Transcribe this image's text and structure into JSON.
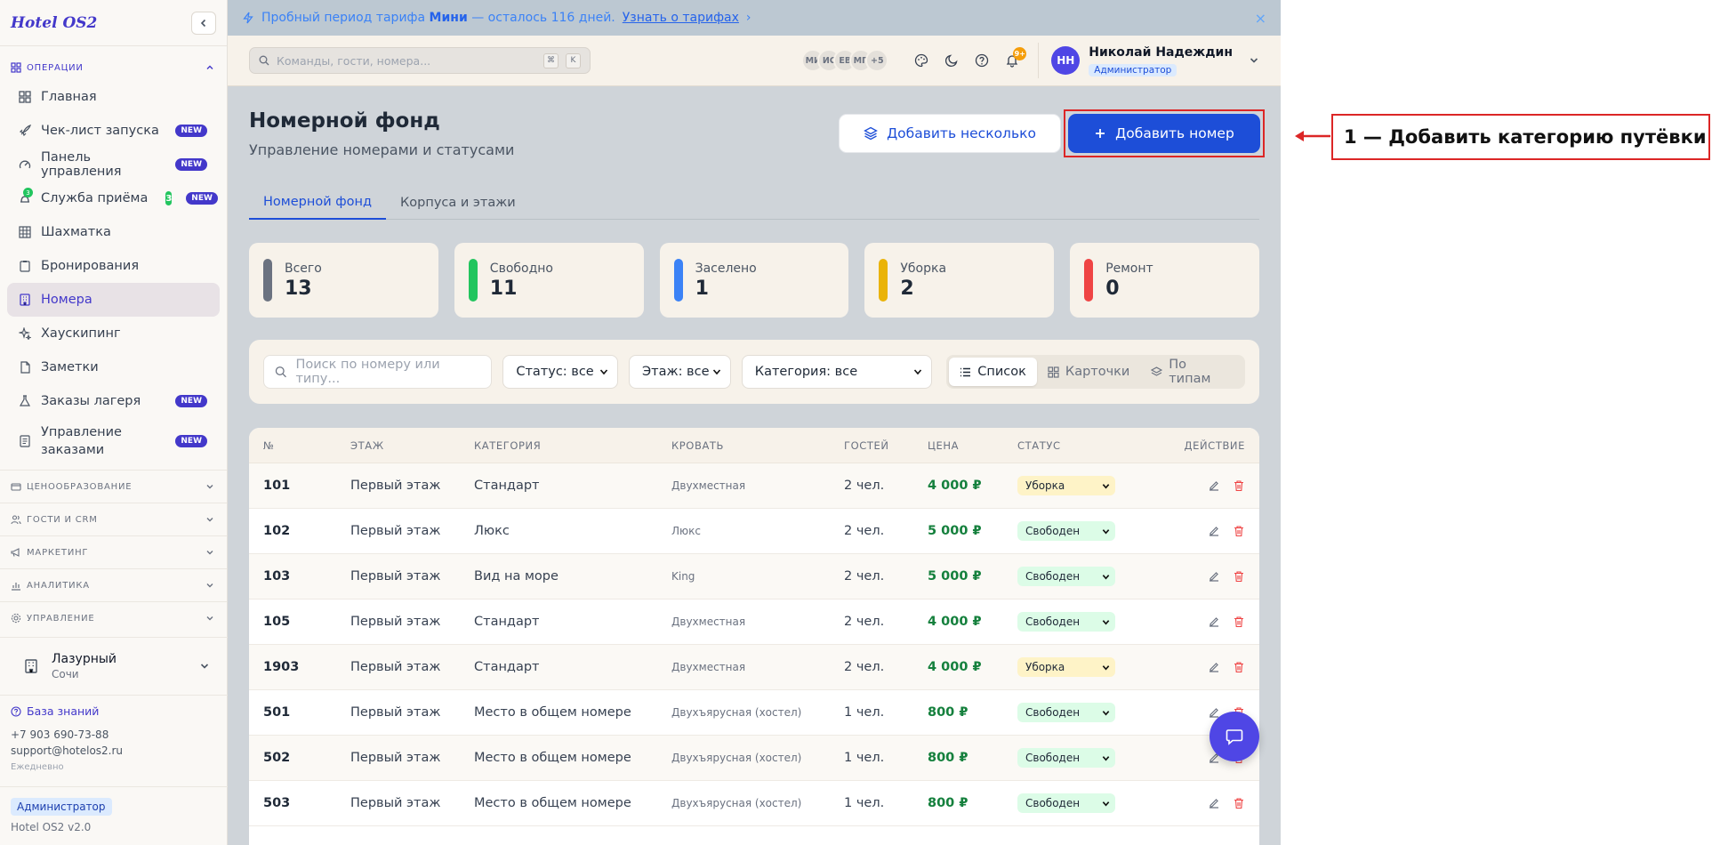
{
  "sidebar": {
    "logo": "Hotel OS2",
    "section_ops": "ОПЕРАЦИИ",
    "items": [
      {
        "label": "Главная",
        "icon": "dashboard-icon",
        "new": false
      },
      {
        "label": "Чек-лист запуска",
        "icon": "rocket-icon",
        "new": true
      },
      {
        "label": "Панель управления",
        "icon": "gauge-icon",
        "new": true
      },
      {
        "label": "Служба приёма",
        "icon": "bell-icon",
        "new": true,
        "count": "3"
      },
      {
        "label": "Шахматка",
        "icon": "grid-icon",
        "new": false
      },
      {
        "label": "Бронирования",
        "icon": "clipboard-icon",
        "new": false
      },
      {
        "label": "Номера",
        "icon": "building-icon",
        "new": false,
        "active": true
      },
      {
        "label": "Хаускипинг",
        "icon": "sparkle-icon",
        "new": false
      },
      {
        "label": "Заметки",
        "icon": "note-icon",
        "new": false
      },
      {
        "label": "Заказы лагеря",
        "icon": "flask-icon",
        "new": true
      },
      {
        "label": "Управление заказами",
        "icon": "list-icon",
        "new": true
      }
    ],
    "new_badge": "NEW",
    "sections": [
      "ЦЕНООБРАЗОВАНИЕ",
      "ГОСТИ И CRM",
      "МАРКЕТИНГ",
      "АНАЛИТИКА",
      "УПРАВЛЕНИЕ"
    ],
    "hotel": {
      "name": "Лазурный",
      "city": "Сочи"
    },
    "footer": {
      "kb_label": "База знаний",
      "phone": "+7 903 690-73-88",
      "email": "support@hotelos2.ru",
      "schedule": "Ежедневно",
      "role": "Администратор",
      "version": "Hotel OS2 v2.0"
    }
  },
  "trial_banner": {
    "text_before": "Пробный период тарифа ",
    "plan": "Мини",
    "text_after": " — осталось 116 дней.",
    "link": "Узнать о тарифах",
    "link_arrow": "›",
    "close": "×"
  },
  "topbar": {
    "search_placeholder": "Команды, гости, номера...",
    "kbd1": "⌘",
    "kbd2": "K",
    "users": [
      "МИ",
      "ИС",
      "ЕВ",
      "МП",
      "+5"
    ],
    "notif_count": "9+",
    "user_initials": "НН",
    "user_name": "Николай Надеждин",
    "user_role": "Администратор"
  },
  "page": {
    "title": "Номерной фонд",
    "subtitle": "Управление номерами и статусами",
    "btn_multi": "Добавить несколько",
    "btn_add": "Добавить номер",
    "tabs": [
      "Номерной фонд",
      "Корпуса и этажи"
    ]
  },
  "stats": [
    {
      "label": "Всего",
      "value": "13",
      "color": "#6b7280"
    },
    {
      "label": "Свободно",
      "value": "11",
      "color": "#22c55e"
    },
    {
      "label": "Заселено",
      "value": "1",
      "color": "#3b82f6"
    },
    {
      "label": "Уборка",
      "value": "2",
      "color": "#eab308"
    },
    {
      "label": "Ремонт",
      "value": "0",
      "color": "#ef4444"
    }
  ],
  "filters": {
    "search_placeholder": "Поиск по номеру или типу...",
    "status": "Статус: все",
    "floor": "Этаж: все",
    "category": "Категория: все",
    "views": [
      "Список",
      "Карточки",
      "По типам"
    ]
  },
  "table": {
    "columns": [
      "№",
      "ЭТАЖ",
      "КАТЕГОРИЯ",
      "КРОВАТЬ",
      "ГОСТЕЙ",
      "ЦЕНА",
      "СТАТУС",
      "ДЕЙСТВИЕ"
    ],
    "rows": [
      {
        "num": "101",
        "floor": "Первый этаж",
        "cat": "Стандарт",
        "bed": "Двухместная",
        "guests": "2 чел.",
        "price": "4 000 ₽",
        "status": "Уборка",
        "kind": "clean"
      },
      {
        "num": "102",
        "floor": "Первый этаж",
        "cat": "Люкс",
        "bed": "Люкс",
        "guests": "2 чел.",
        "price": "5 000 ₽",
        "status": "Свободен",
        "kind": "free"
      },
      {
        "num": "103",
        "floor": "Первый этаж",
        "cat": "Вид на море",
        "bed": "King",
        "guests": "2 чел.",
        "price": "5 000 ₽",
        "status": "Свободен",
        "kind": "free"
      },
      {
        "num": "105",
        "floor": "Первый этаж",
        "cat": "Стандарт",
        "bed": "Двухместная",
        "guests": "2 чел.",
        "price": "4 000 ₽",
        "status": "Свободен",
        "kind": "free"
      },
      {
        "num": "1903",
        "floor": "Первый этаж",
        "cat": "Стандарт",
        "bed": "Двухместная",
        "guests": "2 чел.",
        "price": "4 000 ₽",
        "status": "Уборка",
        "kind": "clean"
      },
      {
        "num": "501",
        "floor": "Первый этаж",
        "cat": "Место в общем номере",
        "bed": "Двухъярусная (хостел)",
        "guests": "1 чел.",
        "price": "800 ₽",
        "status": "Свободен",
        "kind": "free"
      },
      {
        "num": "502",
        "floor": "Первый этаж",
        "cat": "Место в общем номере",
        "bed": "Двухъярусная (хостел)",
        "guests": "1 чел.",
        "price": "800 ₽",
        "status": "Свободен",
        "kind": "free"
      },
      {
        "num": "503",
        "floor": "Первый этаж",
        "cat": "Место в общем номере",
        "bed": "Двухъярусная (хостел)",
        "guests": "1 чел.",
        "price": "800 ₽",
        "status": "Свободен",
        "kind": "free"
      }
    ]
  },
  "annotation": {
    "text": "1 — Добавить категорию путёвки",
    "color": "#dc2626"
  }
}
